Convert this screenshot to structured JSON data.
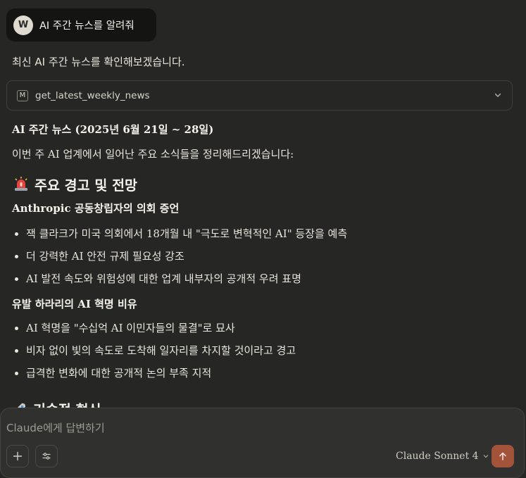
{
  "user_message": {
    "avatar_initial": "W",
    "text": "AI 주간 뉴스를 알려줘"
  },
  "assistant": {
    "intro": "최신 AI 주간 뉴스를 확인해보겠습니다.",
    "tool_call": {
      "icon_letter": "M",
      "name": "get_latest_weekly_news"
    },
    "news_title": "AI 주간 뉴스 (2025년 6월 21일 ~ 28일)",
    "summary": "이번 주 AI 업계에서 일어난 주요 소식들을 정리해드리겠습니다:",
    "section1": {
      "icon": "siren-icon",
      "heading": "주요 경고 및 전망",
      "sub1": {
        "heading": "Anthropic 공동창립자의 의회 증언",
        "items": [
          "잭 클라크가 미국 의회에서 18개월 내 \"극도로 변혁적인 AI\" 등장을 예측",
          "더 강력한 AI 안전 규제 필요성 강조",
          "AI 발전 속도와 위험성에 대한 업계 내부자의 공개적 우려 표명"
        ]
      },
      "sub2": {
        "heading": "유발 하라리의 AI 혁명 비유",
        "items": [
          "AI 혁명을 \"수십억 AI 이민자들의 물결\"로 묘사",
          "비자 없이 빛의 속도로 도착해 일자리를 차지할 것이라고 경고",
          "급격한 변화에 대한 공개적 논의 부족 지적"
        ]
      }
    },
    "section2": {
      "icon": "rocket-icon",
      "heading": "기술적 혁신"
    }
  },
  "composer": {
    "placeholder": "Claude에게 답변하기",
    "model": "Claude Sonnet 4"
  },
  "colors": {
    "background": "#262624",
    "send_button": "#a4533b"
  }
}
